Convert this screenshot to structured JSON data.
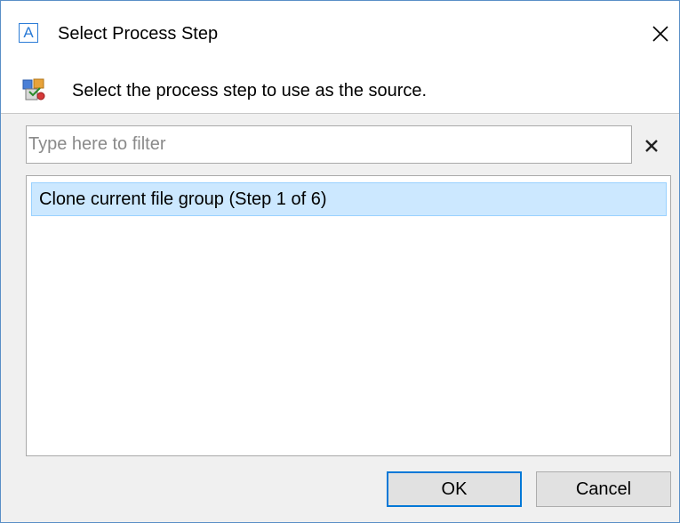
{
  "dialog": {
    "title": "Select Process Step",
    "app_icon_letter": "A",
    "instruction": "Select the process step to use as the source."
  },
  "filter": {
    "placeholder": "Type here to filter",
    "value": ""
  },
  "list": {
    "items": [
      {
        "label": "Clone current file group (Step 1 of 6)",
        "selected": true
      }
    ]
  },
  "buttons": {
    "ok": "OK",
    "cancel": "Cancel"
  },
  "icons": {
    "app": "app-logo-icon",
    "close": "close-icon",
    "step": "process-step-icon",
    "clear": "clear-filter-icon"
  },
  "colors": {
    "selection_bg": "#cce8ff",
    "selection_border": "#99d1ff",
    "default_button_border": "#0078d7",
    "window_border": "#5a8fc7"
  }
}
